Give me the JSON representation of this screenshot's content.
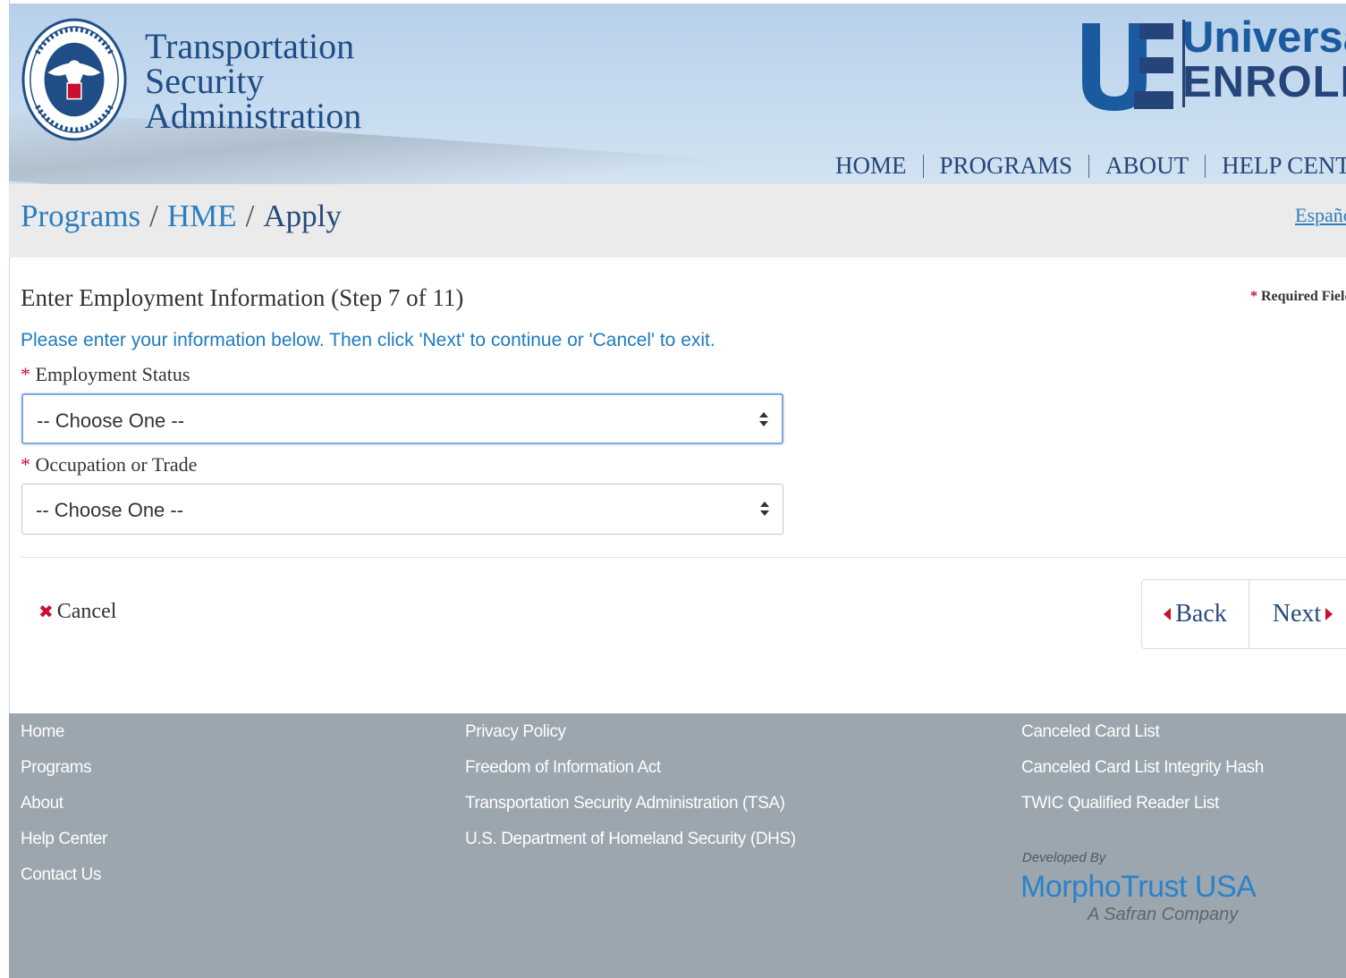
{
  "header": {
    "agency_lines": [
      "Transportation",
      "Security",
      "Administration"
    ],
    "brand_line1": "Universal",
    "brand_line2": "ENROLL",
    "nav": [
      "HOME",
      "PROGRAMS",
      "ABOUT",
      "HELP CENTER"
    ]
  },
  "breadcrumb": {
    "items": [
      "Programs",
      "HME",
      "Apply"
    ],
    "language_link": "Español"
  },
  "form": {
    "title": "Enter Employment Information (Step 7 of 11)",
    "required_note": "Required Fields",
    "required_star": "*",
    "instructions": "Please enter your information below. Then click 'Next' to continue or 'Cancel' to exit.",
    "fields": [
      {
        "label": "Employment Status",
        "value": "-- Choose One --"
      },
      {
        "label": "Occupation or Trade",
        "value": "-- Choose One --"
      }
    ]
  },
  "actions": {
    "cancel": "Cancel",
    "back": "Back",
    "next": "Next"
  },
  "footer": {
    "col1": [
      "Home",
      "Programs",
      "About",
      "Help Center",
      "Contact Us"
    ],
    "col2": [
      "Privacy Policy",
      "Freedom of Information Act",
      "Transportation Security Administration (TSA)",
      "U.S. Department of Homeland Security (DHS)"
    ],
    "col3": [
      "Canceled Card List",
      "Canceled Card List Integrity Hash",
      "TWIC Qualified Reader List"
    ],
    "developed_by": "Developed By",
    "developer": "MorphoTrust USA",
    "developer_tagline": "A Safran Company"
  },
  "colors": {
    "brand_blue": "#1f4e87",
    "link_blue": "#2b7ec0",
    "required_red": "#c8102e",
    "footer_bg": "#9ba6ae"
  },
  "icons": {
    "seal": "dhs-seal-icon",
    "cancel": "x-icon",
    "back": "caret-left-icon",
    "next": "caret-right-icon",
    "select": "updown-arrows-icon"
  }
}
